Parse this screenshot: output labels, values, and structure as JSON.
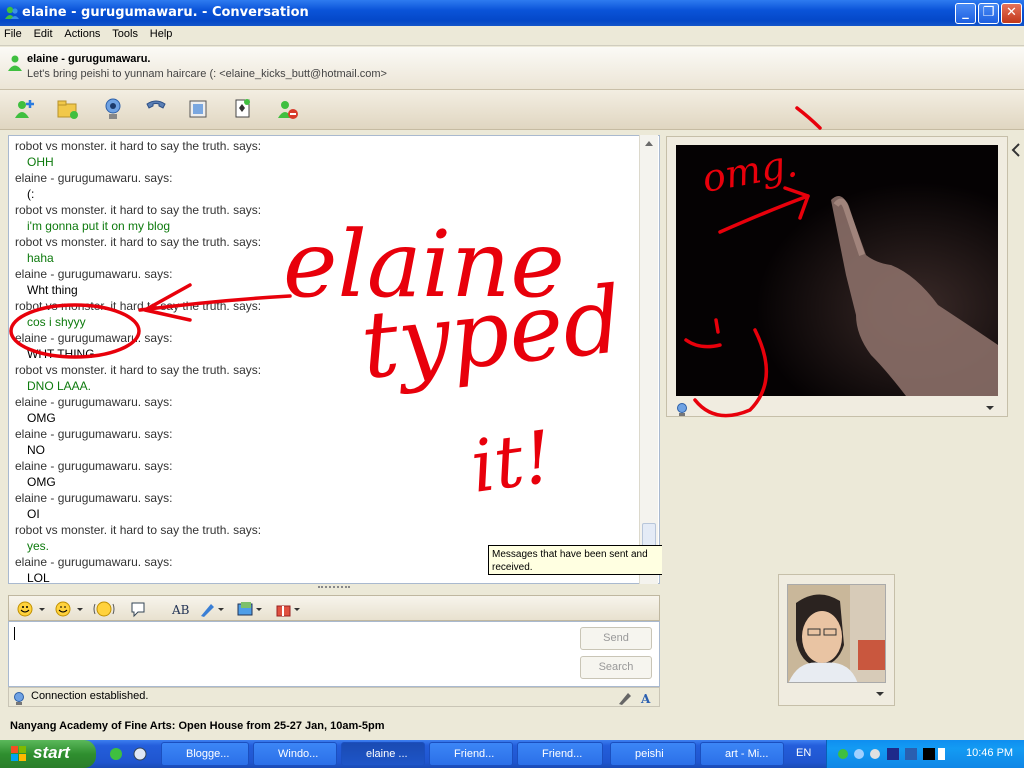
{
  "window": {
    "title": "elaine - gurugumawaru. - Conversation"
  },
  "menu": [
    "File",
    "Edit",
    "Actions",
    "Tools",
    "Help"
  ],
  "contact": {
    "name": "elaine - gurugumawaru.",
    "status_line": "Let's bring peishi to yunnam haircare (: <elaine_kicks_butt@hotmail.com>"
  },
  "toolbar_icons": [
    "invite-contact-icon",
    "send-files-icon",
    "webcam-icon",
    "call-icon",
    "activities-icon",
    "games-icon",
    "block-icon"
  ],
  "chat": [
    {
      "who": "robot vs monster. it hard to say the truth. says:",
      "msg": "OHH",
      "color": "green"
    },
    {
      "who": "elaine - gurugumawaru. says:",
      "msg": "(:",
      "color": "black"
    },
    {
      "who": "robot vs monster. it hard to say the truth. says:",
      "msg": "i'm gonna put it on my blog",
      "color": "green"
    },
    {
      "who": "robot vs monster. it hard to say the truth. says:",
      "msg": "haha",
      "color": "green"
    },
    {
      "who": "elaine - gurugumawaru. says:",
      "msg": "Wht thing",
      "color": "black"
    },
    {
      "who": "robot vs monster. it hard to say the truth. says:",
      "msg": "cos i shyyy",
      "color": "green"
    },
    {
      "who": "elaine - gurugumawaru. says:",
      "msg": "WHT THING",
      "color": "black"
    },
    {
      "who": "robot vs monster. it hard to say the truth. says:",
      "msg": "DNO LAAA.",
      "color": "green"
    },
    {
      "who": "elaine - gurugumawaru. says:",
      "msg": "OMG",
      "color": "black"
    },
    {
      "who": "elaine - gurugumawaru. says:",
      "msg": "NO",
      "color": "black"
    },
    {
      "who": "elaine - gurugumawaru. says:",
      "msg": "OMG",
      "color": "black"
    },
    {
      "who": "elaine - gurugumawaru. says:",
      "msg": "OI",
      "color": "black"
    },
    {
      "who": "robot vs monster. it hard to say the truth. says:",
      "msg": "yes.",
      "color": "green"
    },
    {
      "who": "elaine - gurugumawaru. says:",
      "msg": "LOL",
      "color": "black"
    }
  ],
  "tooltip": "Messages that have been sent and received.",
  "input": {
    "value": "",
    "send_label": "Send",
    "search_label": "Search"
  },
  "status": "Connection established.",
  "ad": "Nanyang Academy of Fine Arts: Open House from 25-27 Jan, 10am-5pm",
  "annotations": {
    "name": "elaine",
    "typed": "typed",
    "it": "it!",
    "omg": "omg."
  },
  "taskbar": {
    "start_label": "start",
    "tasks": [
      "Blogge...",
      "Windo...",
      "elaine ...",
      "Friend...",
      "Friend...",
      "peishi",
      "art - Mi..."
    ],
    "language": "EN",
    "clock": "10:46 PM"
  },
  "colors": {
    "accent": "#0a53d8",
    "green_text": "#0d7a0d",
    "scribble": "#e8000b"
  }
}
